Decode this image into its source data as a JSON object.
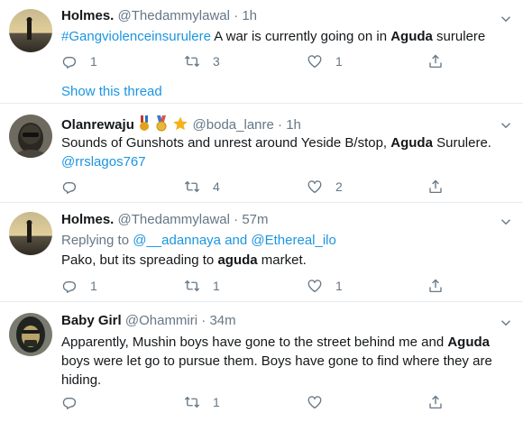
{
  "tweets": [
    {
      "name": "Holmes.",
      "handle": "@Thedammylawal",
      "sep": "·",
      "time": "1h",
      "hashtag": "#Gangviolenceinsurulere",
      "text_pre": " A war is currently going on in ",
      "keyword": "Aguda",
      "text_post": " surulere",
      "replies": "1",
      "retweets": "3",
      "likes": "1",
      "show_thread": "Show this thread"
    },
    {
      "name": "Olanrewaju",
      "handle": "@boda_lanre",
      "sep": "·",
      "time": "1h",
      "text_pre": "Sounds of Gunshots and unrest around Yeside B/stop, ",
      "keyword": "Aguda",
      "text_post": " Surulere.",
      "mention": "@rrslagos767",
      "replies": "",
      "retweets": "4",
      "likes": "2"
    },
    {
      "name": "Holmes.",
      "handle": "@Thedammylawal",
      "sep": "·",
      "time": "57m",
      "replying_prefix": "Replying to ",
      "replying_to_1": "@__adannaya",
      "replying_and": " and ",
      "replying_to_2": "@Ethereal_ilo",
      "text_pre": "Pako, but its spreading to ",
      "keyword": "aguda",
      "text_post": " market.",
      "replies": "1",
      "retweets": "1",
      "likes": "1"
    },
    {
      "name": "Baby Girl",
      "handle": "@Ohammiri",
      "sep": "·",
      "time": "34m",
      "text_pre": "Apparently, Mushin boys have gone to the street behind me and ",
      "keyword": "Aguda",
      "text_post": " boys were let go to pursue them. Boys have gone to find where they are hiding.",
      "replies": "",
      "retweets": "1",
      "likes": ""
    }
  ],
  "colors": {
    "link": "#1b95e0",
    "muted": "#657786",
    "border": "#e6ecf0"
  }
}
